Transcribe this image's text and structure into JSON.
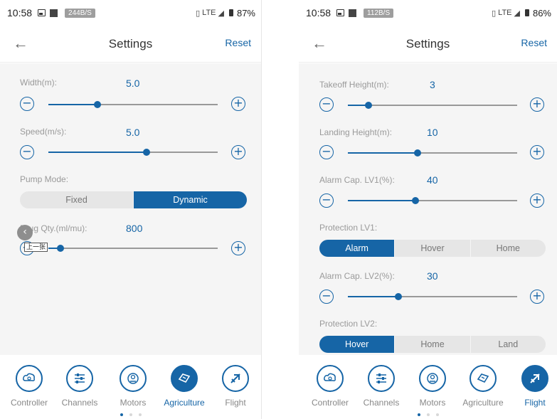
{
  "colors": {
    "accent": "#1665a6",
    "inactive": "#e6e6e6",
    "background": "#f5f5f5"
  },
  "left": {
    "status": {
      "time": "10:58",
      "speed": "244B/S",
      "network": "LTE",
      "battery": "87%"
    },
    "header": {
      "back_icon": "arrow-left-icon",
      "title": "Settings",
      "reset": "Reset"
    },
    "width": {
      "label": "Width(m):",
      "value": "5.0",
      "level": 0.29
    },
    "speed": {
      "label": "Speed(m/s):",
      "value": "5.0",
      "level": 0.58
    },
    "pump": {
      "label": "Pump Mode:",
      "options": [
        "Fixed",
        "Dynamic"
      ],
      "selected": "Dynamic"
    },
    "drug": {
      "label": "Drug Qty.(ml/mu):",
      "value": "800",
      "level": 0.07
    },
    "tooltip": {
      "text": "上一张",
      "icon": "chevron-left-icon"
    },
    "tabs": [
      {
        "label": "Controller",
        "icon": "controller-icon"
      },
      {
        "label": "Channels",
        "icon": "channels-icon"
      },
      {
        "label": "Motors",
        "icon": "motors-icon"
      },
      {
        "label": "Agriculture",
        "icon": "agriculture-icon",
        "active": true
      },
      {
        "label": "Flight",
        "icon": "flight-icon"
      }
    ]
  },
  "right": {
    "status": {
      "time": "10:58",
      "speed": "112B/S",
      "network": "LTE",
      "battery": "86%"
    },
    "header": {
      "back_icon": "arrow-left-icon",
      "title": "Settings",
      "reset": "Reset"
    },
    "takeoff": {
      "label": "Takeoff Height(m):",
      "value": "3",
      "level": 0.12
    },
    "landing": {
      "label": "Landing Height(m):",
      "value": "10",
      "level": 0.41
    },
    "alarm1": {
      "label": "Alarm Cap. LV1(%):",
      "value": "40",
      "level": 0.4
    },
    "prot1": {
      "label": "Protection LV1:",
      "options": [
        "Alarm",
        "Hover",
        "Home"
      ],
      "selected": "Alarm"
    },
    "alarm2": {
      "label": "Alarm Cap. LV2(%):",
      "value": "30",
      "level": 0.3
    },
    "prot2": {
      "label": "Protection LV2:",
      "options": [
        "Hover",
        "Home",
        "Land"
      ],
      "selected": "Hover"
    },
    "tabs": [
      {
        "label": "Controller",
        "icon": "controller-icon"
      },
      {
        "label": "Channels",
        "icon": "channels-icon"
      },
      {
        "label": "Motors",
        "icon": "motors-icon"
      },
      {
        "label": "Agriculture",
        "icon": "agriculture-icon"
      },
      {
        "label": "Flight",
        "icon": "flight-icon",
        "active": true
      }
    ]
  }
}
